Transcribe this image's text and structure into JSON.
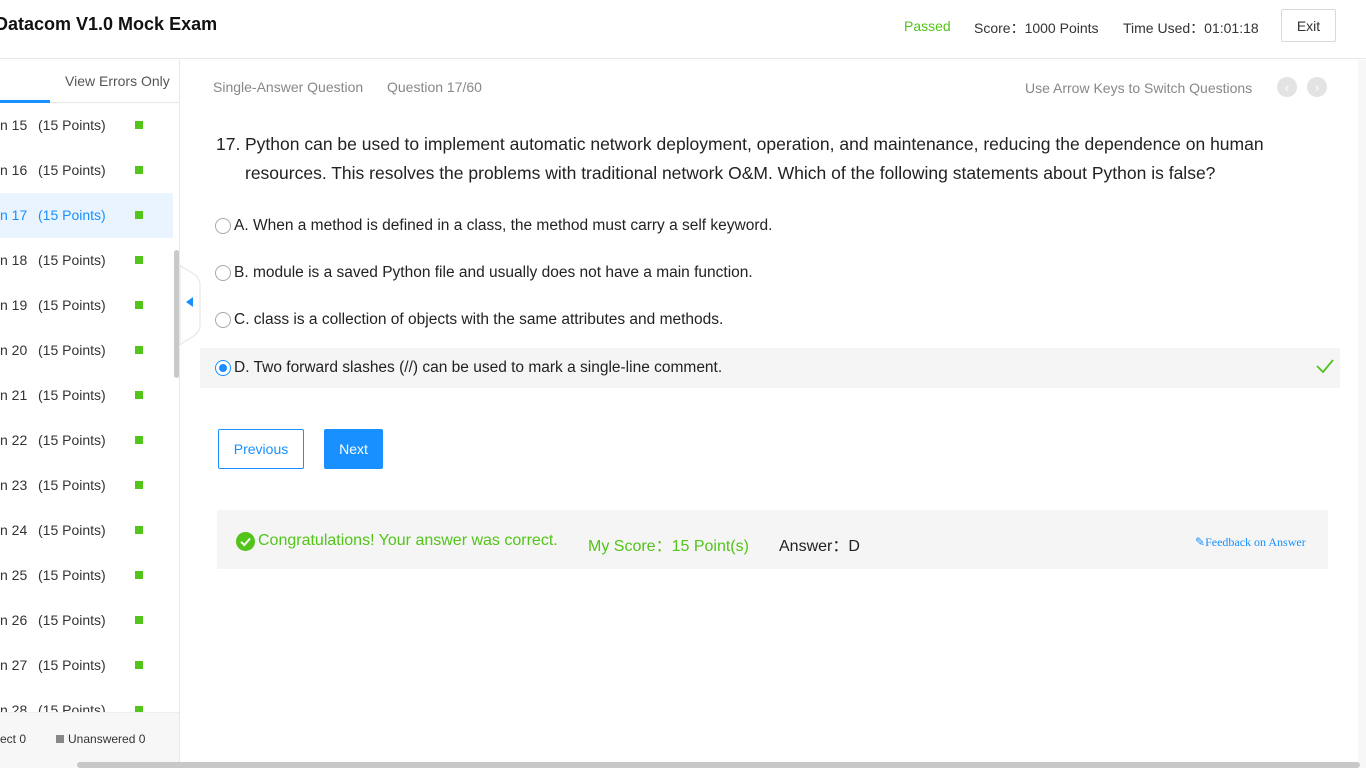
{
  "header": {
    "title": "Datacom V1.0 Mock Exam",
    "status": "Passed",
    "score": "Score：1000 Points",
    "time_used": "Time Used：01:01:18",
    "exit_label": "Exit"
  },
  "sidebar": {
    "view_errors_label": "View Errors Only",
    "items": [
      {
        "num": "n 15",
        "points": "(15 Points)"
      },
      {
        "num": "n 16",
        "points": "(15 Points)"
      },
      {
        "num": "n 17",
        "points": "(15 Points)"
      },
      {
        "num": "n 18",
        "points": "(15 Points)"
      },
      {
        "num": "n 19",
        "points": "(15 Points)"
      },
      {
        "num": "n 20",
        "points": "(15 Points)"
      },
      {
        "num": "n 21",
        "points": "(15 Points)"
      },
      {
        "num": "n 22",
        "points": "(15 Points)"
      },
      {
        "num": "n 23",
        "points": "(15 Points)"
      },
      {
        "num": "n 24",
        "points": "(15 Points)"
      },
      {
        "num": "n 25",
        "points": "(15 Points)"
      },
      {
        "num": "n 26",
        "points": "(15 Points)"
      },
      {
        "num": "n 27",
        "points": "(15 Points)"
      },
      {
        "num": "n 28",
        "points": "(15 Points)"
      }
    ],
    "active_index": 2,
    "legend_correct": "ect 0",
    "legend_unanswered": "Unanswered 0"
  },
  "question": {
    "type": "Single-Answer Question",
    "index": "Question 17/60",
    "arrow_hint": "Use Arrow Keys to Switch Questions",
    "number": "17.",
    "stem": "Python can be used to implement automatic network deployment, operation, and maintenance, reducing the dependence on human resources. This resolves the problems with traditional network O&M. Which of the following statements about Python is false?",
    "options": [
      "A. When a method is defined in a class, the method must carry a self keyword.",
      "B. module is a saved Python file and usually does not have a main function.",
      "C. class is a collection of objects with the same attributes and methods.",
      "D. Two forward slashes (//) can be used to mark a single-line comment."
    ],
    "selected_option": 3
  },
  "buttons": {
    "previous": "Previous",
    "next": "Next"
  },
  "result": {
    "message": "Congratulations! Your answer was correct.",
    "my_score": "My Score：15 Point(s)",
    "answer": "Answer：D",
    "feedback": "Feedback on Answer"
  },
  "colors": {
    "accent": "#1890ff",
    "success": "#52c41a"
  }
}
